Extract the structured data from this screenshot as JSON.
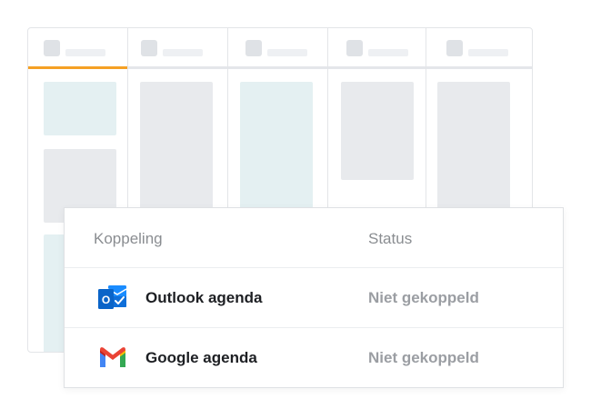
{
  "table": {
    "headers": {
      "name": "Koppeling",
      "status": "Status"
    },
    "rows": [
      {
        "name": "Outlook agenda",
        "status": "Niet gekoppeld",
        "icon": "outlook-icon"
      },
      {
        "name": "Google agenda",
        "status": "Niet gekoppeld",
        "icon": "gmail-icon"
      }
    ]
  },
  "colors": {
    "accent_tab": "#f5a024",
    "outlook_blue": "#0a64c8",
    "gmail_red": "#ea4335",
    "gmail_blue": "#4285f4",
    "gmail_green": "#34a853",
    "gmail_yellow": "#fbbc04"
  }
}
